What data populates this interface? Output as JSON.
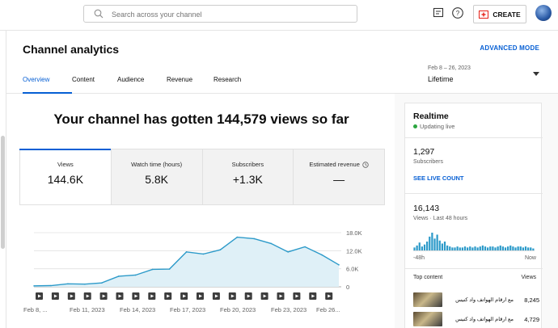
{
  "topbar": {
    "search_placeholder": "Search across your channel",
    "create_label": "CREATE"
  },
  "header": {
    "title": "Channel analytics",
    "advanced_mode": "ADVANCED MODE",
    "tabs": [
      {
        "label": "Overview",
        "active": true
      },
      {
        "label": "Content",
        "active": false
      },
      {
        "label": "Audience",
        "active": false
      },
      {
        "label": "Revenue",
        "active": false
      },
      {
        "label": "Research",
        "active": false
      }
    ],
    "date_range": "Feb 8 – 26, 2023",
    "date_value": "Lifetime"
  },
  "main": {
    "headline": "Your channel has gotten 144,579 views so far",
    "metrics": [
      {
        "label": "Views",
        "value": "144.6K",
        "selected": true
      },
      {
        "label": "Watch time (hours)",
        "value": "5.8K"
      },
      {
        "label": "Subscribers",
        "value": "+1.3K"
      },
      {
        "label": "Estimated revenue",
        "value": "—"
      }
    ]
  },
  "chart_data": {
    "type": "area",
    "x_tick_labels": [
      "Feb 8, ...",
      "Feb 11, 2023",
      "Feb 14, 2023",
      "Feb 17, 2023",
      "Feb 20, 2023",
      "Feb 23, 2023",
      "Feb 26..."
    ],
    "y_tick_labels": [
      "18.0K",
      "12.0K",
      "6.0K",
      "0"
    ],
    "ylim": [
      0,
      18000
    ],
    "values": [
      300,
      400,
      1000,
      900,
      1300,
      3500,
      3900,
      5800,
      5900,
      11600,
      10900,
      12300,
      16500,
      16000,
      14400,
      11600,
      13300,
      10600,
      7300
    ],
    "color": "#2c9ac9",
    "grid": true
  },
  "realtime": {
    "title": "Realtime",
    "status": "Updating live",
    "subs_value": "1,297",
    "subs_label": "Subscribers",
    "live_count": "SEE LIVE COUNT",
    "views_value": "16,143",
    "views_label": "Views · Last 48 hours",
    "axis_left": "-48h",
    "axis_right": "Now",
    "bars": [
      3,
      5,
      8,
      4,
      6,
      9,
      14,
      18,
      12,
      16,
      10,
      7,
      9,
      5,
      4,
      3,
      3,
      4,
      3,
      3,
      4,
      3,
      4,
      3,
      4,
      3,
      4,
      5,
      4,
      3,
      4,
      4,
      3,
      4,
      5,
      4,
      3,
      4,
      5,
      4,
      3,
      4,
      4,
      3,
      4,
      3,
      3,
      2
    ],
    "top_content_label": "Top content",
    "views_col": "Views",
    "content": [
      {
        "title": "مع ارقام الهواتف واد كنيس",
        "views": "8,245"
      },
      {
        "title": "مع ارقام الهواتف واد كنيس",
        "views": "4,729"
      }
    ]
  }
}
